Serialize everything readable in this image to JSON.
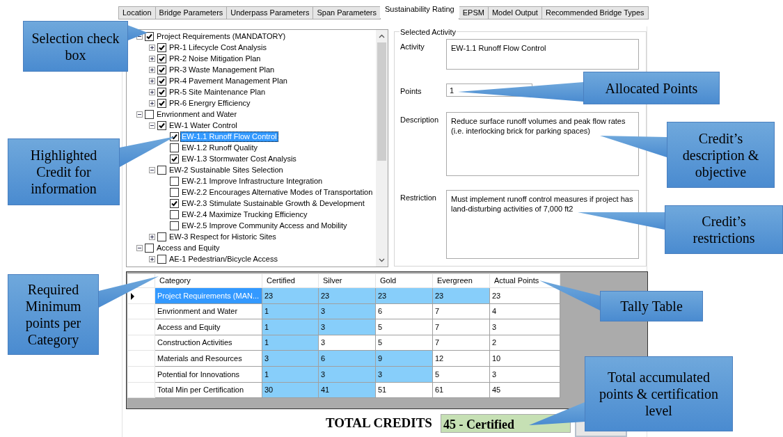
{
  "tabs": [
    {
      "label": "Location",
      "selected": false
    },
    {
      "label": "Bridge Parameters",
      "selected": false
    },
    {
      "label": "Underpass Parameters",
      "selected": false
    },
    {
      "label": "Span Parameters",
      "selected": false
    },
    {
      "label": "Sustainability Rating",
      "selected": true
    },
    {
      "label": "EPSM",
      "selected": false
    },
    {
      "label": "Model Output",
      "selected": false
    },
    {
      "label": "Recommended Bridge Types",
      "selected": false
    }
  ],
  "tree": [
    {
      "label": "Project Requirements (MANDATORY)",
      "checked": true,
      "expanded": true,
      "selected": false,
      "children": [
        {
          "label": "PR-1 Lifecycle Cost Analysis",
          "checked": true,
          "expanded": false,
          "selected": false
        },
        {
          "label": "PR-2 Noise Mitigation Plan",
          "checked": true,
          "expanded": false,
          "selected": false
        },
        {
          "label": "PR-3 Waste Management Plan",
          "checked": true,
          "expanded": false,
          "selected": false
        },
        {
          "label": "PR-4 Pavement Management Plan",
          "checked": true,
          "expanded": false,
          "selected": false
        },
        {
          "label": "PR-5 Site Maintenance Plan",
          "checked": true,
          "expanded": false,
          "selected": false
        },
        {
          "label": "PR-6 Energry Efficiency",
          "checked": true,
          "expanded": false,
          "selected": false
        }
      ]
    },
    {
      "label": "Envrionment and Water",
      "checked": false,
      "expanded": true,
      "selected": false,
      "children": [
        {
          "label": "EW-1 Water Control",
          "checked": true,
          "expanded": true,
          "selected": false,
          "children": [
            {
              "label": "EW-1.1 Runoff Flow Control",
              "checked": true,
              "selected": true
            },
            {
              "label": "EW-1.2 Runoff Quality",
              "checked": false,
              "selected": false
            },
            {
              "label": "EW-1.3 Stormwater Cost Analysis",
              "checked": true,
              "selected": false
            }
          ]
        },
        {
          "label": "EW-2 Sustainable Sites Selection",
          "checked": false,
          "expanded": true,
          "selected": false,
          "children": [
            {
              "label": "EW-2.1 Improve Infrastructure Integration",
              "checked": false,
              "selected": false
            },
            {
              "label": "EW-2.2 Encourages Alternative Modes of Transportation",
              "checked": false,
              "selected": false
            },
            {
              "label": "EW-2.3 Stimulate Sustainable Growth & Development",
              "checked": true,
              "selected": false
            },
            {
              "label": "EW-2.4 Maximize Trucking Efficiency",
              "checked": false,
              "selected": false
            },
            {
              "label": "EW-2.5 Improve Community Access and Mobility",
              "checked": false,
              "selected": false
            }
          ]
        },
        {
          "label": "EW-3 Respect for Historic Sites",
          "checked": false,
          "expanded": false,
          "selected": false
        }
      ]
    },
    {
      "label": "Access and Equity",
      "checked": false,
      "expanded": true,
      "selected": false,
      "children": [
        {
          "label": "AE-1 Pedestrian/Bicycle Access",
          "checked": false,
          "expanded": false,
          "selected": false
        }
      ]
    }
  ],
  "selected_activity": {
    "title": "Selected Activity",
    "fields": [
      {
        "label": "Activity",
        "value": "EW-1.1 Runoff Flow Control",
        "kind": "box"
      },
      {
        "label": "Points",
        "value": "1",
        "kind": "line"
      },
      {
        "label": "Description",
        "value": "Reduce surface runoff volumes and peak flow rates (i.e. interlocking brick for parking spaces)",
        "kind": "area"
      },
      {
        "label": "Restriction",
        "value": "Must implement runoff control measures if project has land-disturbing activities of 7,000 ft2",
        "kind": "area"
      }
    ]
  },
  "table": {
    "columns": [
      "Category",
      "Certified",
      "Silver",
      "Gold",
      "Evergreen",
      "Actual Points"
    ],
    "rows": [
      {
        "category": "Project Requirements (MAN...",
        "current": true,
        "selected": true,
        "tiers": [
          {
            "value": "23",
            "met": true
          },
          {
            "value": "23",
            "met": true
          },
          {
            "value": "23",
            "met": true
          },
          {
            "value": "23",
            "met": true
          }
        ],
        "actual": "23"
      },
      {
        "category": "Envrionment and Water",
        "current": false,
        "selected": false,
        "tiers": [
          {
            "value": "1",
            "met": true
          },
          {
            "value": "3",
            "met": true
          },
          {
            "value": "6",
            "met": false
          },
          {
            "value": "7",
            "met": false
          }
        ],
        "actual": "4"
      },
      {
        "category": "Access and Equity",
        "current": false,
        "selected": false,
        "tiers": [
          {
            "value": "1",
            "met": true
          },
          {
            "value": "3",
            "met": true
          },
          {
            "value": "5",
            "met": false
          },
          {
            "value": "7",
            "met": false
          }
        ],
        "actual": "3"
      },
      {
        "category": "Construction Activities",
        "current": false,
        "selected": false,
        "tiers": [
          {
            "value": "1",
            "met": true
          },
          {
            "value": "3",
            "met": false
          },
          {
            "value": "5",
            "met": false
          },
          {
            "value": "7",
            "met": false
          }
        ],
        "actual": "2"
      },
      {
        "category": "Materials and Resources",
        "current": false,
        "selected": false,
        "tiers": [
          {
            "value": "3",
            "met": true
          },
          {
            "value": "6",
            "met": true
          },
          {
            "value": "9",
            "met": true
          },
          {
            "value": "12",
            "met": false
          }
        ],
        "actual": "10"
      },
      {
        "category": "Potential for Innovations",
        "current": false,
        "selected": false,
        "tiers": [
          {
            "value": "1",
            "met": true
          },
          {
            "value": "3",
            "met": true
          },
          {
            "value": "3",
            "met": true
          },
          {
            "value": "5",
            "met": false
          }
        ],
        "actual": "3"
      },
      {
        "category": "Total Min per Certification",
        "current": false,
        "selected": false,
        "tiers": [
          {
            "value": "30",
            "met": true
          },
          {
            "value": "41",
            "met": true
          },
          {
            "value": "51",
            "met": false
          },
          {
            "value": "61",
            "met": false
          }
        ],
        "actual": "45"
      }
    ]
  },
  "total": {
    "label": "TOTAL CREDITS",
    "value": "45 - Certified"
  },
  "annotations": [
    {
      "text": "Selection check box"
    },
    {
      "text": "Highlighted Credit for information"
    },
    {
      "text": "Required Minimum points per Category"
    },
    {
      "text": "Allocated Points"
    },
    {
      "text": "Credit’s description & objective"
    },
    {
      "text": "Credit’s restrictions"
    },
    {
      "text": "Tally Table"
    },
    {
      "text": "Total accumulated points & certification level"
    }
  ]
}
